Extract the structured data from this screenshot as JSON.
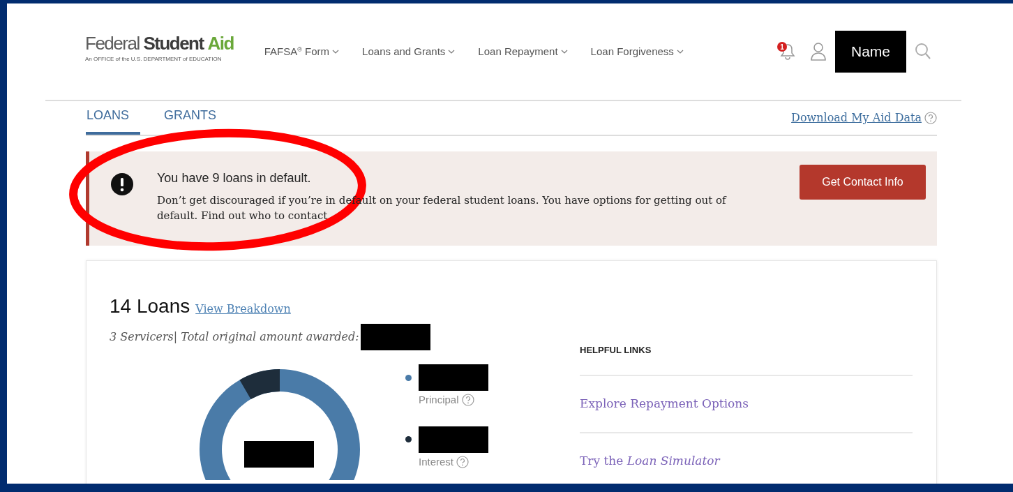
{
  "header": {
    "logo": {
      "part_1": "Federal",
      "part_2": "Student",
      "part_3": "Aid",
      "tagline": "An OFFICE of the U.S. DEPARTMENT of EDUCATION"
    },
    "nav": [
      {
        "label": "FAFSA$^{®}$ Form"
      },
      {
        "label": "Loans and Grants"
      },
      {
        "label": "Loan Repayment"
      },
      {
        "label": "Loan Forgiveness"
      }
    ],
    "notification_count": "1",
    "user_name": "Name"
  },
  "tabs": [
    {
      "label": "LOANS",
      "selected": true
    },
    {
      "label": "GRANTS",
      "selected": false
    }
  ],
  "download_link": "Download My Aid Data",
  "alert": {
    "title": "You have 9 loans in default.",
    "body": "Don’t get discouraged if you’re in default on your federal student loans. You have options for getting out of default. Find out who to contact",
    "button": "Get Contact Info"
  },
  "summary": {
    "count": "14 Loans",
    "link": "View Breakdown",
    "subtitle": "3 Servicers| Total original amount awarded:",
    "legend": [
      {
        "label": "Principal",
        "color": "#4a7ba8"
      },
      {
        "label": "Interest",
        "color": "#1e2d3b"
      }
    ]
  },
  "helpful_links": {
    "heading": "HELPFUL LINKS",
    "links": [
      "Explore Repayment Options",
      "Try the *Loan Simulator*"
    ]
  },
  "annotation": {
    "kind": "ellipse"
  }
}
